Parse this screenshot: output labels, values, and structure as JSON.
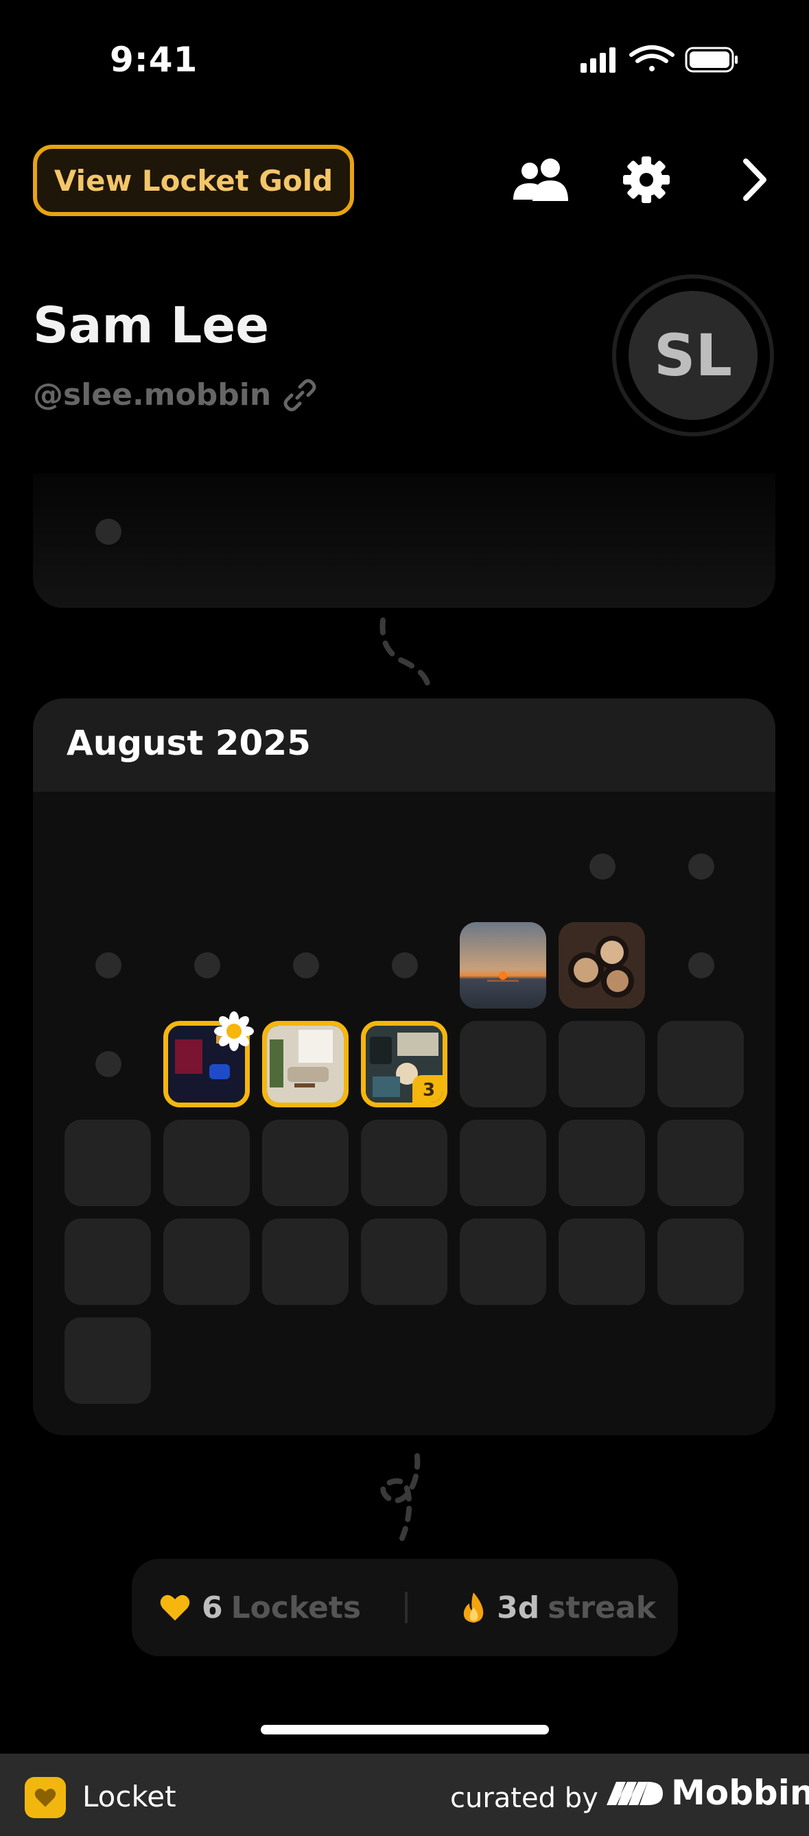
{
  "status_bar": {
    "time": "9:41"
  },
  "header": {
    "gold_button_label": "View Locket Gold",
    "icons": [
      "friends-icon",
      "gear-icon",
      "chevron-right-icon"
    ]
  },
  "profile": {
    "name": "Sam Lee",
    "handle": "@slee.mobbin",
    "initials": "SL"
  },
  "calendar": {
    "month_title": "August 2025",
    "highlight_color": "#f5b60e",
    "stacked_photo_count": "3"
  },
  "stats": {
    "lockets_count": "6",
    "lockets_label": "Lockets",
    "streak_value": "3d",
    "streak_label": "streak"
  },
  "footer": {
    "app_name": "Locket",
    "curated_by": "curated by",
    "brand": "Mobbin"
  }
}
